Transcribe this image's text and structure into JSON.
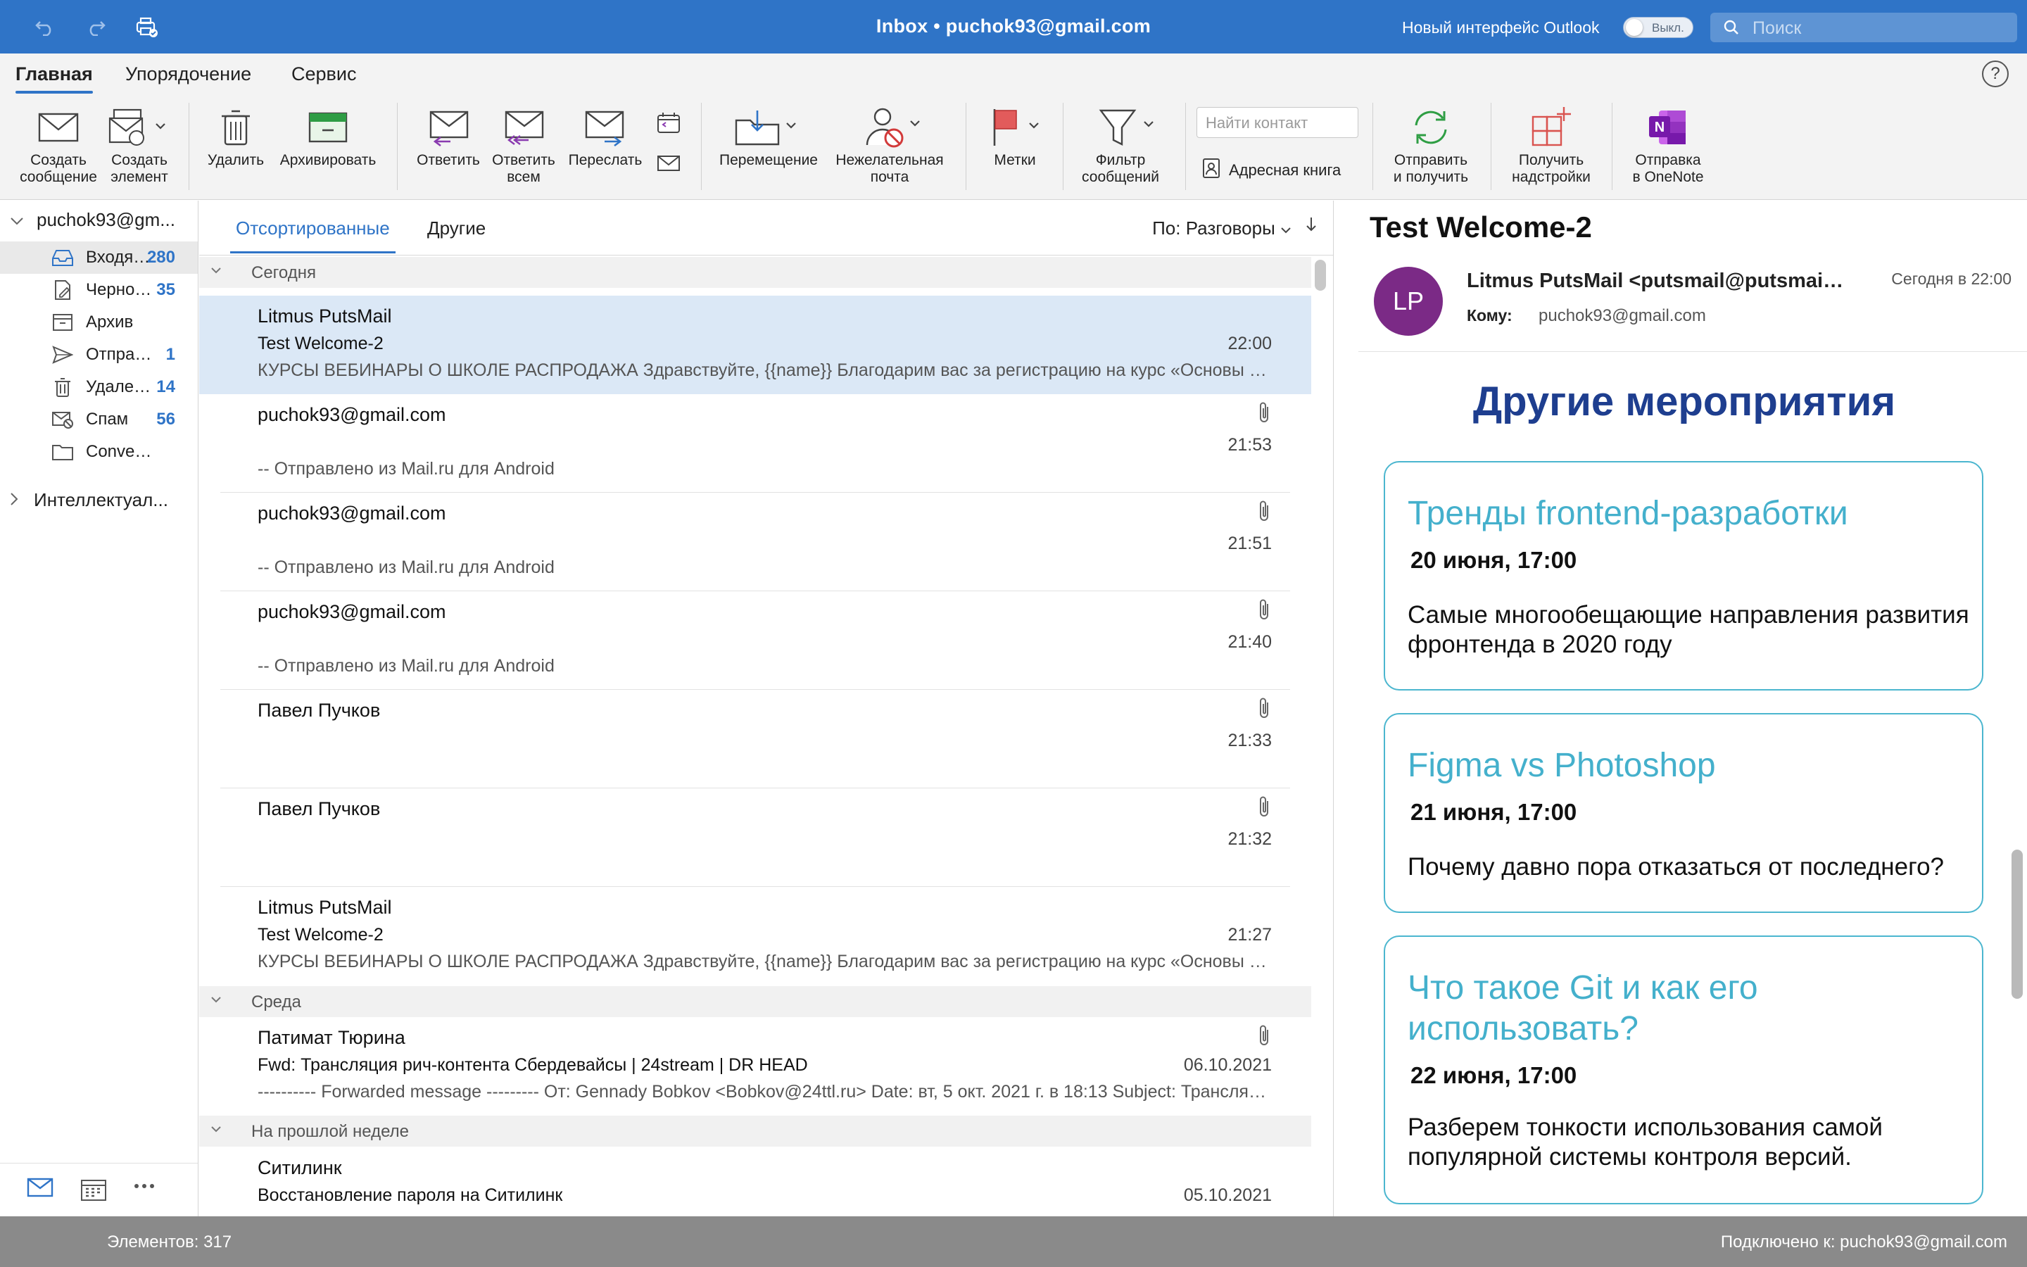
{
  "window": {
    "title": "Inbox • puchok93@gmail.com",
    "new_ui_label": "Новый интерфейс Outlook",
    "toggle_label": "Выкл.",
    "search_placeholder": "Поиск"
  },
  "ribbon": {
    "tabs": [
      "Главная",
      "Упорядочение",
      "Сервис"
    ],
    "buttons": {
      "new_message": [
        "Создать",
        "сообщение"
      ],
      "new_item": [
        "Создать",
        "элемент"
      ],
      "delete": "Удалить",
      "archive": "Архивировать",
      "reply": "Ответить",
      "reply_all": [
        "Ответить",
        "всем"
      ],
      "forward": "Переслать",
      "move": "Перемещение",
      "junk": [
        "Нежелательная",
        "почта"
      ],
      "flags": "Метки",
      "filter": [
        "Фильтр",
        "сообщений"
      ],
      "find_contact_placeholder": "Найти контакт",
      "address_book": "Адресная книга",
      "send_receive": [
        "Отправить",
        "и получить"
      ],
      "get_addins": [
        "Получить",
        "надстройки"
      ],
      "onenote": [
        "Отправка",
        "в OneNote"
      ]
    },
    "help": "?"
  },
  "folders": {
    "account": "puchok93@gm...",
    "items": [
      {
        "name": "Входящие",
        "count": "280",
        "icon": "inbox-icon"
      },
      {
        "name": "Черновики",
        "count": "35",
        "icon": "drafts-icon"
      },
      {
        "name": "Архив",
        "count": "",
        "icon": "archive-icon"
      },
      {
        "name": "Отправленные",
        "count": "1",
        "icon": "sent-icon"
      },
      {
        "name": "Удаленные",
        "count": "14",
        "icon": "trash-icon"
      },
      {
        "name": "Спам",
        "count": "56",
        "icon": "spam-icon"
      },
      {
        "name": "Conversation History",
        "count": "",
        "icon": "folder-icon"
      }
    ],
    "smart_folder": "Интеллектуал..."
  },
  "list": {
    "tabs": [
      "Отсортированные",
      "Другие"
    ],
    "sort_label": "По: Разговоры",
    "groups": {
      "today": "Сегодня",
      "wednesday": "Среда",
      "last_week": "На прошлой неделе"
    },
    "messages": [
      {
        "from": "Litmus PutsMail",
        "subject": "Test Welcome-2",
        "preview": "КУРСЫ ВЕБИНАРЫ О ШКОЛЕ РАСПРОДАЖА Здравствуйте, {{name}} Благодарим вас за регистрацию на курс «Основы веб-разработки»",
        "time": "22:00"
      },
      {
        "from": "puchok93@gmail.com",
        "subject": "",
        "preview": "-- Отправлено из Mail.ru для Android",
        "time": "21:53"
      },
      {
        "from": "puchok93@gmail.com",
        "subject": "",
        "preview": "-- Отправлено из Mail.ru для Android",
        "time": "21:51"
      },
      {
        "from": "puchok93@gmail.com",
        "subject": "",
        "preview": "-- Отправлено из Mail.ru для Android",
        "time": "21:40"
      },
      {
        "from": "Павел Пучков",
        "subject": "",
        "preview": "",
        "time": "21:33"
      },
      {
        "from": "Павел Пучков",
        "subject": "",
        "preview": "",
        "time": "21:32"
      },
      {
        "from": "Litmus PutsMail",
        "subject": "Test Welcome-2",
        "preview": "КУРСЫ ВЕБИНАРЫ О ШКОЛЕ РАСПРОДАЖА Здравствуйте, {{name}} Благодарим вас за регистрацию на курс «Основы веб-разработки»",
        "time": "21:27"
      },
      {
        "from": "Патимат Тюрина",
        "subject": "Fwd: Трансляция рич-контента Сбердевайсы | 24stream | DR HEAD",
        "preview": "---------- Forwarded message --------- От: Gennady Bobkov <Bobkov@24ttl.ru> Date: вт, 5 окт. 2021 г. в 18:13 Subject: Трансляция",
        "time": "06.10.2021"
      },
      {
        "from": "Ситилинк",
        "subject": "Восстановление пароля на Ситилинк",
        "preview": "",
        "time": "05.10.2021"
      }
    ]
  },
  "reading": {
    "subject": "Test Welcome-2",
    "avatar_initials": "LP",
    "from": "Litmus PutsMail <putsmail@putsmail.com>",
    "date": "Сегодня в 22:00",
    "to_label": "Кому:",
    "to": "puchok93@gmail.com",
    "body": {
      "heading": "Другие мероприятия",
      "cards": [
        {
          "title": "Тренды frontend-разработки",
          "date": "20 июня, 17:00",
          "text": "Самые многообещающие направления развития фронтенда в 2020 году"
        },
        {
          "title": "Figma vs Photoshop",
          "date": "21 июня, 17:00",
          "text": "Почему давно пора отказаться от последнего?"
        },
        {
          "title": "Что такое Git и как его использовать?",
          "date": "22 июня, 17:00",
          "text": "Разберем тонкости использования самой популярной системы контроля версий."
        }
      ]
    }
  },
  "status": {
    "items": "Элементов: 317",
    "connected": "Подключено к: puchok93@gmail.com"
  },
  "colors": {
    "titlebar": "#2f74c7",
    "accent": "#2f74c7",
    "selected_row": "#dbe8f6",
    "heading_navy": "#1e3e8f",
    "card_teal": "#44b0cc",
    "avatar_purple": "#7b2a86",
    "statusbar": "#8a8a8a"
  }
}
